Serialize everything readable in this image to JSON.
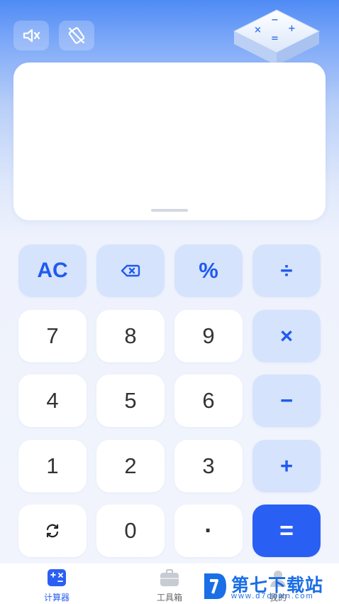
{
  "header": {
    "sound_icon": "speaker-muted-icon",
    "rotate_icon": "rotation-lock-off-icon"
  },
  "display": {
    "expression": "",
    "result": ""
  },
  "keypad": {
    "rows": [
      [
        {
          "label": "AC",
          "kind": "function",
          "icon": ""
        },
        {
          "label": "",
          "kind": "function",
          "icon": "backspace-icon"
        },
        {
          "label": "%",
          "kind": "function",
          "icon": ""
        },
        {
          "label": "÷",
          "kind": "operator",
          "icon": ""
        }
      ],
      [
        {
          "label": "7",
          "kind": "digit",
          "icon": ""
        },
        {
          "label": "8",
          "kind": "digit",
          "icon": ""
        },
        {
          "label": "9",
          "kind": "digit",
          "icon": ""
        },
        {
          "label": "×",
          "kind": "operator",
          "icon": ""
        }
      ],
      [
        {
          "label": "4",
          "kind": "digit",
          "icon": ""
        },
        {
          "label": "5",
          "kind": "digit",
          "icon": ""
        },
        {
          "label": "6",
          "kind": "digit",
          "icon": ""
        },
        {
          "label": "−",
          "kind": "operator",
          "icon": ""
        }
      ],
      [
        {
          "label": "1",
          "kind": "digit",
          "icon": ""
        },
        {
          "label": "2",
          "kind": "digit",
          "icon": ""
        },
        {
          "label": "3",
          "kind": "digit",
          "icon": ""
        },
        {
          "label": "+",
          "kind": "operator",
          "icon": ""
        }
      ],
      [
        {
          "label": "",
          "kind": "digit",
          "icon": "switch-icon"
        },
        {
          "label": "0",
          "kind": "digit",
          "icon": ""
        },
        {
          "label": "·",
          "kind": "digit",
          "icon": ""
        },
        {
          "label": "=",
          "kind": "equals",
          "icon": ""
        }
      ]
    ]
  },
  "tabs": [
    {
      "label": "计算器",
      "icon": "calculator-icon",
      "active": true
    },
    {
      "label": "工具箱",
      "icon": "toolbox-icon",
      "active": false
    },
    {
      "label": "我的",
      "icon": "profile-icon",
      "active": false
    }
  ],
  "watermark": {
    "title": "第七下载站",
    "url": "www.d7down.com"
  },
  "colors": {
    "accent": "#2a5ff3",
    "key_tint": "#d6e3fc"
  }
}
